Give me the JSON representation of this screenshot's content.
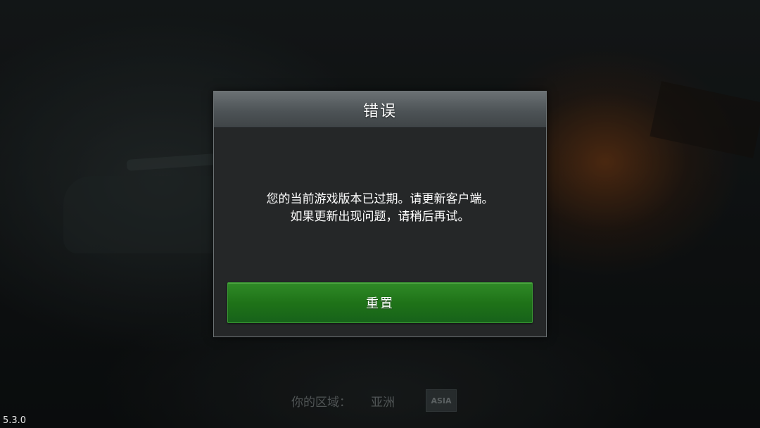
{
  "dialog": {
    "title": "错误",
    "message_line1": "您的当前游戏版本已过期。请更新客户端。",
    "message_line2": "如果更新出现问题，请稍后再试。",
    "reset_label": "重置"
  },
  "region": {
    "label": "你的区域：",
    "value": "亚洲",
    "badge": "ASIA"
  },
  "version": "5.3.0",
  "colors": {
    "button_green": "#1f7318",
    "dialog_bg": "#252728",
    "header_bg": "#4d5356"
  }
}
